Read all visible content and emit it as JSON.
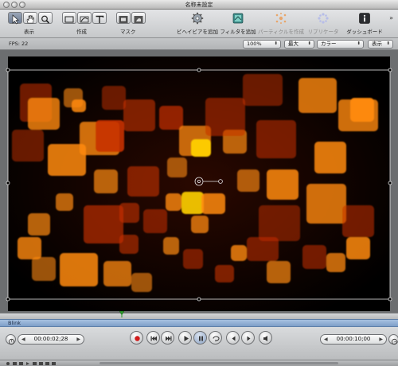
{
  "window": {
    "title": "名称未設定"
  },
  "toolbar": {
    "view_label": "表示",
    "create_label": "作成",
    "mask_label": "マスク",
    "add_behavior_label": "ビヘイビアを追加",
    "add_filter_label": "フィルタを追加",
    "make_particles_label": "パーティクルを作成",
    "replicator_label": "リプリケータ",
    "dashboard_label": "ダッシュボード"
  },
  "viewer": {
    "fps_label": "FPS: 22",
    "zoom_value": "100%",
    "quality_value": "最大",
    "channel_value": "カラー",
    "view_menu_value": "表示"
  },
  "timeline": {
    "track_name": "Blink"
  },
  "transport": {
    "current_time": "00:00:02;28",
    "duration_time": "00:00:10;00"
  },
  "colors": {
    "canvas_bg": "#000000",
    "bokeh_orange": "#ff8a10",
    "bokeh_red": "#c83000",
    "bokeh_yellow": "#ffd000",
    "track_blue": "#8faed5"
  }
}
